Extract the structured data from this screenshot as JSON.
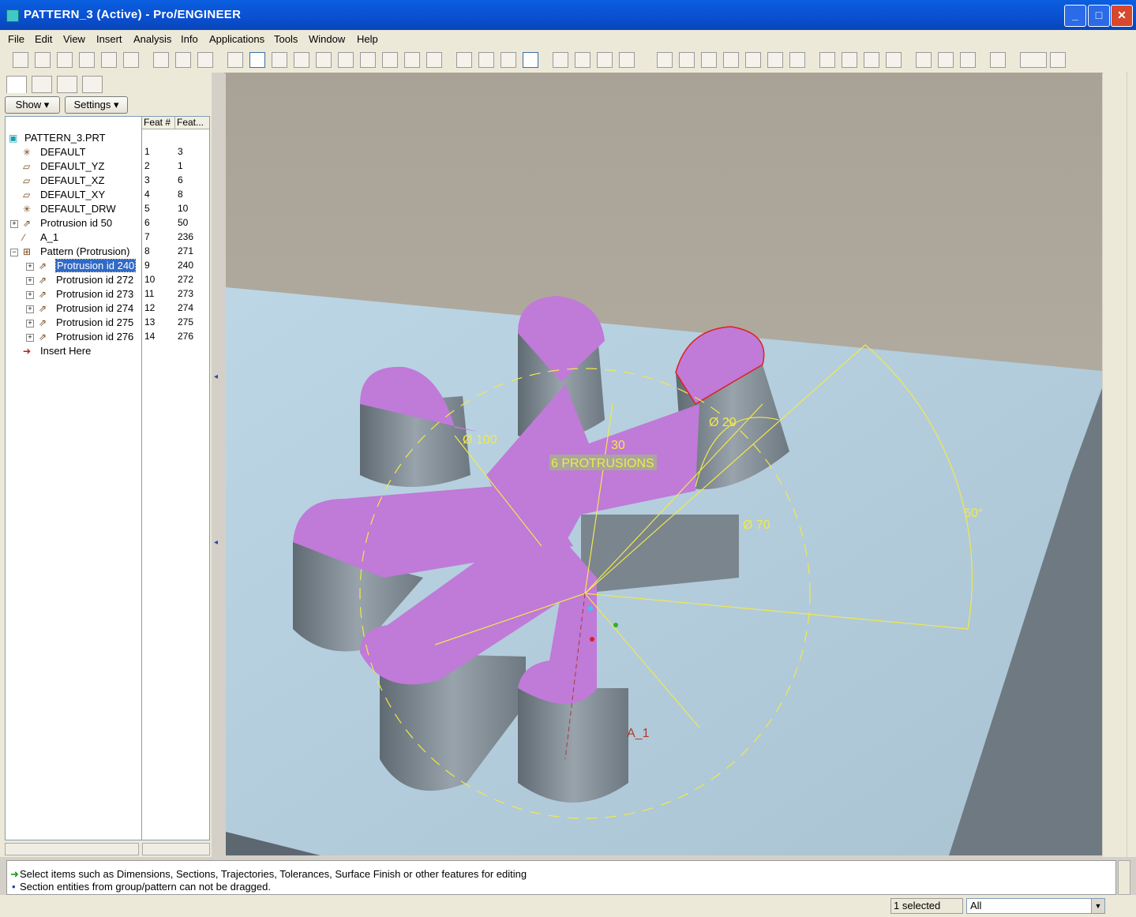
{
  "window": {
    "title": "PATTERN_3 (Active) - Pro/ENGINEER",
    "minimize": "_",
    "maximize": "□",
    "close": "✕"
  },
  "menu": [
    "File",
    "Edit",
    "View",
    "Insert",
    "Analysis",
    "Info",
    "Applications",
    "Tools",
    "Window",
    "Help"
  ],
  "nav": {
    "show_label": "Show",
    "settings_label": "Settings"
  },
  "tree": {
    "columns": [
      "Feat #",
      "Feat..."
    ],
    "items": [
      {
        "label": "PATTERN_3.PRT",
        "feat_num": "",
        "feat_id": "",
        "icon": "part-icon"
      },
      {
        "label": "DEFAULT",
        "feat_num": "1",
        "feat_id": "3",
        "icon": "csys-icon"
      },
      {
        "label": "DEFAULT_YZ",
        "feat_num": "2",
        "feat_id": "1",
        "icon": "datum-plane-icon"
      },
      {
        "label": "DEFAULT_XZ",
        "feat_num": "3",
        "feat_id": "6",
        "icon": "datum-plane-icon"
      },
      {
        "label": "DEFAULT_XY",
        "feat_num": "4",
        "feat_id": "8",
        "icon": "datum-plane-icon"
      },
      {
        "label": "DEFAULT_DRW",
        "feat_num": "5",
        "feat_id": "10",
        "icon": "csys-icon"
      },
      {
        "label": "Protrusion id 50",
        "feat_num": "6",
        "feat_id": "50",
        "icon": "protrusion-icon"
      },
      {
        "label": "A_1",
        "feat_num": "7",
        "feat_id": "236",
        "icon": "datum-axis-icon"
      },
      {
        "label": "Pattern (Protrusion)",
        "feat_num": "8",
        "feat_id": "271",
        "icon": "pattern-icon"
      },
      {
        "label": "Protrusion id 240",
        "feat_num": "9",
        "feat_id": "240",
        "icon": "protrusion-icon"
      },
      {
        "label": "Protrusion id 272",
        "feat_num": "10",
        "feat_id": "272",
        "icon": "protrusion-icon"
      },
      {
        "label": "Protrusion id 273",
        "feat_num": "11",
        "feat_id": "273",
        "icon": "protrusion-icon"
      },
      {
        "label": "Protrusion id 274",
        "feat_num": "12",
        "feat_id": "274",
        "icon": "protrusion-icon"
      },
      {
        "label": "Protrusion id 275",
        "feat_num": "13",
        "feat_id": "275",
        "icon": "protrusion-icon"
      },
      {
        "label": "Protrusion id 276",
        "feat_num": "14",
        "feat_id": "276",
        "icon": "protrusion-icon"
      },
      {
        "label": "Insert Here",
        "feat_num": "",
        "feat_id": "",
        "icon": "insert-arrow-icon"
      }
    ]
  },
  "model": {
    "dims": {
      "d100": "Ø 100",
      "d20": "Ø 20",
      "d70": "Ø 70",
      "d30": "30",
      "d60": "60°"
    },
    "pattern_note": "6 PROTRUSIONS",
    "axis_label": "A_1",
    "colors": {
      "cap": "#c07ad8",
      "side": "#7f8a93",
      "base": "#b4cfe0",
      "dim": "#f2e84a",
      "bg": "#b3aca0"
    }
  },
  "messages": [
    "Select items such as Dimensions, Sections, Trajectories, Tolerances, Surface Finish or other features for editing",
    "Section entities from group/pattern can not be dragged."
  ],
  "status": {
    "selected": "1 selected",
    "filter": "All"
  }
}
